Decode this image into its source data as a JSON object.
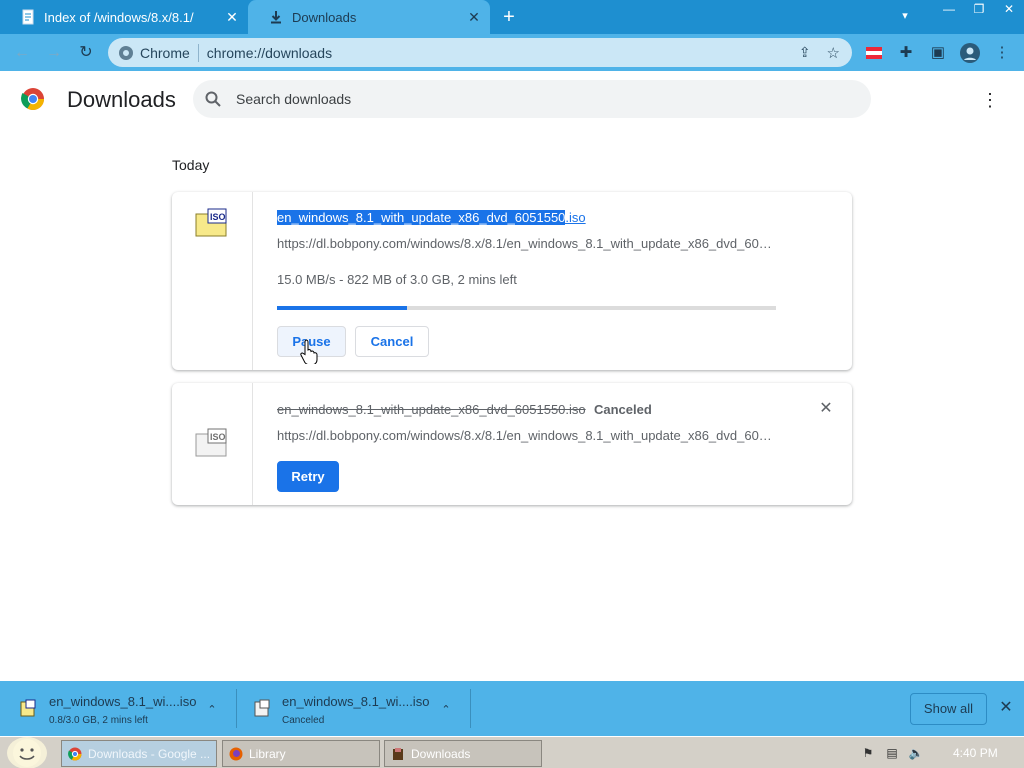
{
  "tabs": [
    {
      "title": "Index of /windows/8.x/8.1/",
      "icon": "page-icon",
      "close": "✕"
    },
    {
      "title": "Downloads",
      "icon": "download-icon",
      "close": "✕"
    }
  ],
  "new_tab_symbol": "+",
  "window_controls": {
    "minimize": "—",
    "restore": "❐",
    "close": "✕"
  },
  "address_bar": {
    "site_label": "Chrome",
    "url": "chrome://downloads"
  },
  "page": {
    "title": "Downloads",
    "search_placeholder": "Search downloads",
    "section_title": "Today"
  },
  "downloads": [
    {
      "filename_highlighted": "en_windows_8.1_with_update_x86_dvd_6051550",
      "filename_rest": ".iso",
      "url": "https://dl.bobpony.com/windows/8.x/8.1/en_windows_8.1_with_update_x86_dvd_60…",
      "status": "15.0 MB/s - 822 MB of 3.0 GB, 2 mins left",
      "progress_fraction": 0.26,
      "buttons": {
        "pause": "Pause",
        "cancel": "Cancel"
      }
    },
    {
      "filename": "en_windows_8.1_with_update_x86_dvd_6051550.iso",
      "state": "Canceled",
      "url": "https://dl.bobpony.com/windows/8.x/8.1/en_windows_8.1_with_update_x86_dvd_60…",
      "buttons": {
        "retry": "Retry",
        "remove": "✕"
      }
    }
  ],
  "shelf": {
    "items": [
      {
        "name": "en_windows_8.1_wi....iso",
        "sub": "0.8/3.0 GB, 2 mins left",
        "caret": "⌃"
      },
      {
        "name": "en_windows_8.1_wi....iso",
        "sub": "Canceled",
        "caret": "⌃"
      }
    ],
    "show_all": "Show all",
    "close": "✕"
  },
  "taskbar": {
    "tasks": [
      "Downloads - Google ...",
      "Library",
      "Downloads"
    ],
    "clock": "4:40 PM"
  },
  "colors": {
    "accent": "#1a73e8",
    "tabbar": "#1e8fd0",
    "toolbar": "#4fb3e8"
  }
}
